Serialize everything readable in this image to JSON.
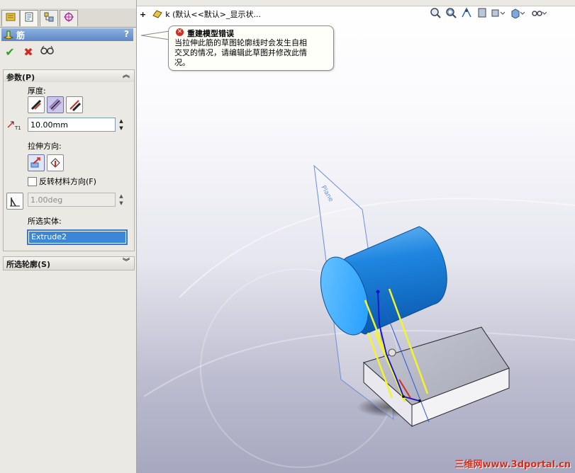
{
  "property_manager": {
    "tabs": [
      "feature-manager",
      "property-manager",
      "configuration-manager",
      "dimxpert-manager"
    ],
    "title": "筋",
    "help": "?",
    "actions": {
      "ok": "✔",
      "cancel": "✖",
      "preview": "6o"
    },
    "params": {
      "header": "参数(P)",
      "thickness_label": "厚度:",
      "thickness_value": "10.00mm",
      "direction_label": "拉伸方向:",
      "flip_label": "反转材料方向(F)",
      "flip_checked": false,
      "draft_value": "1.00deg",
      "selected_bodies_label": "所选实体:",
      "selected_body": "Extrude2"
    },
    "contours_header": "所选轮廓(S)"
  },
  "graphics": {
    "tree_item": "k  (默认<<默认>_显示状..."
  },
  "error_balloon": {
    "title": "重建模型错误",
    "message": "当拉伸此筋的草图轮廓线时会发生自相交叉的情况，请编辑此草图并修改此情况。"
  },
  "watermark": "三维网www.3dportal.cn",
  "colors": {
    "accent": "#5d88c6",
    "cylinder": "#1e86e0",
    "error": "#d42a24",
    "rib_lines": "#f4f42a",
    "selection": "#3c86d8"
  }
}
